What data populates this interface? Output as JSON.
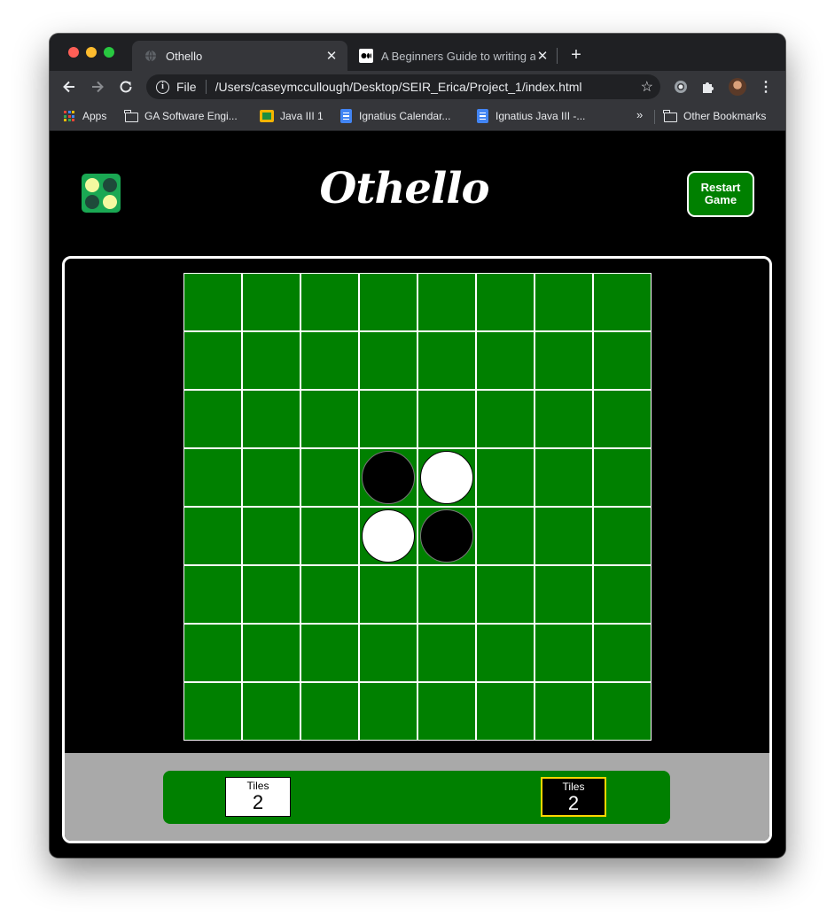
{
  "browser": {
    "tabs": [
      {
        "title": "Othello",
        "favicon": "globe-icon",
        "active": true
      },
      {
        "title": "A Beginners Guide to writing a",
        "favicon": "medium-icon",
        "active": false
      }
    ],
    "address": {
      "scheme": "File",
      "url": "/Users/caseymccullough/Desktop/SEIR_Erica/Project_1/index.html"
    },
    "bookmarks": [
      {
        "label": "Apps",
        "icon": "apps-grid-icon"
      },
      {
        "label": "GA Software Engi...",
        "icon": "folder-icon"
      },
      {
        "label": "Java III 1",
        "icon": "google-classroom-icon"
      },
      {
        "label": "Ignatius Calendar...",
        "icon": "google-docs-icon"
      },
      {
        "label": "Ignatius Java III -...",
        "icon": "google-docs-icon"
      },
      {
        "label": "Other Bookmarks",
        "icon": "folder-icon"
      }
    ],
    "bookmarks_overflow": "»"
  },
  "game": {
    "title": "Othello",
    "restart_label": "Restart\nGame",
    "colors": {
      "board": "#008000",
      "logo": "#1aa853",
      "logo_light": "#f4f9a0",
      "logo_dark": "#1e4a3a",
      "score_area": "#a9a9a9",
      "active_player_border": "#ffd700"
    },
    "board": {
      "size": 8,
      "discs": [
        {
          "row": 3,
          "col": 3,
          "color": "black"
        },
        {
          "row": 3,
          "col": 4,
          "color": "white"
        },
        {
          "row": 4,
          "col": 3,
          "color": "white"
        },
        {
          "row": 4,
          "col": 4,
          "color": "black"
        }
      ]
    },
    "scores": {
      "white": {
        "label": "Tiles",
        "count": "2"
      },
      "black": {
        "label": "Tiles",
        "count": "2",
        "active": true
      }
    }
  }
}
